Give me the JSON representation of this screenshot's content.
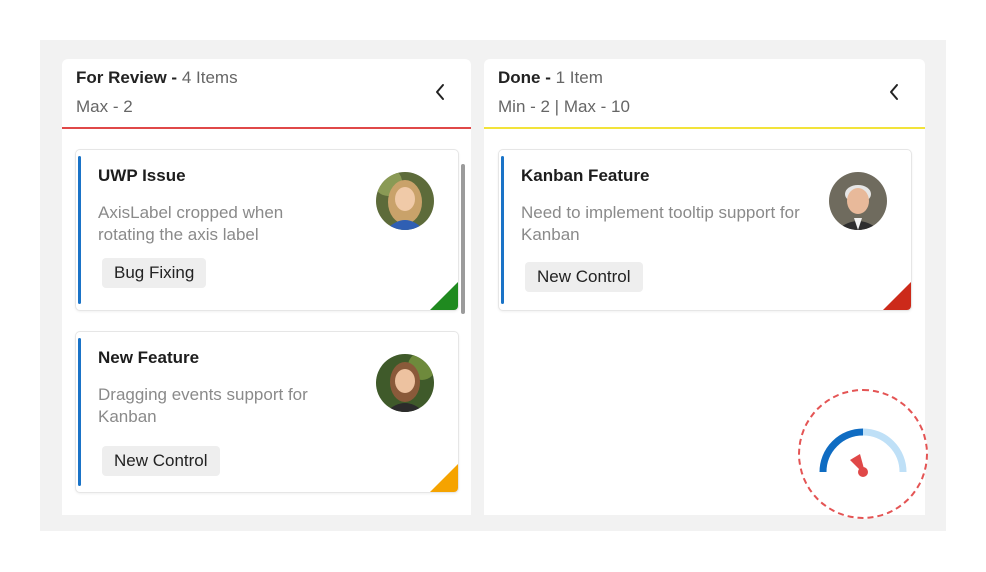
{
  "columns": [
    {
      "title": "For Review -",
      "count": "4  Items",
      "limit": "Max - 2",
      "divider_color": "#e04848",
      "cards": [
        {
          "title": "UWP Issue",
          "description": "AxisLabel cropped when rotating the axis label",
          "tag": "Bug Fixing",
          "priority_color": "#1f8a1f"
        },
        {
          "title": "New Feature",
          "description": "Dragging events support for Kanban",
          "tag": "New Control",
          "priority_color": "#f5a300"
        }
      ]
    },
    {
      "title": "Done -",
      "count": "1  Item",
      "limit": "Min - 2 | Max - 10",
      "divider_color": "#f2e33a",
      "cards": [
        {
          "title": "Kanban Feature",
          "description": "Need to implement tooltip support for Kanban",
          "tag": "New Control",
          "priority_color": "#cc2a1a"
        }
      ]
    }
  ],
  "icons": {
    "collapse": "chevron-left-icon",
    "badge": "speedometer-icon"
  },
  "colors": {
    "card_accent": "#1a73c7",
    "gauge_dark": "#0f6cc2",
    "gauge_light": "#bfe0f7",
    "gauge_needle": "#e04848"
  }
}
